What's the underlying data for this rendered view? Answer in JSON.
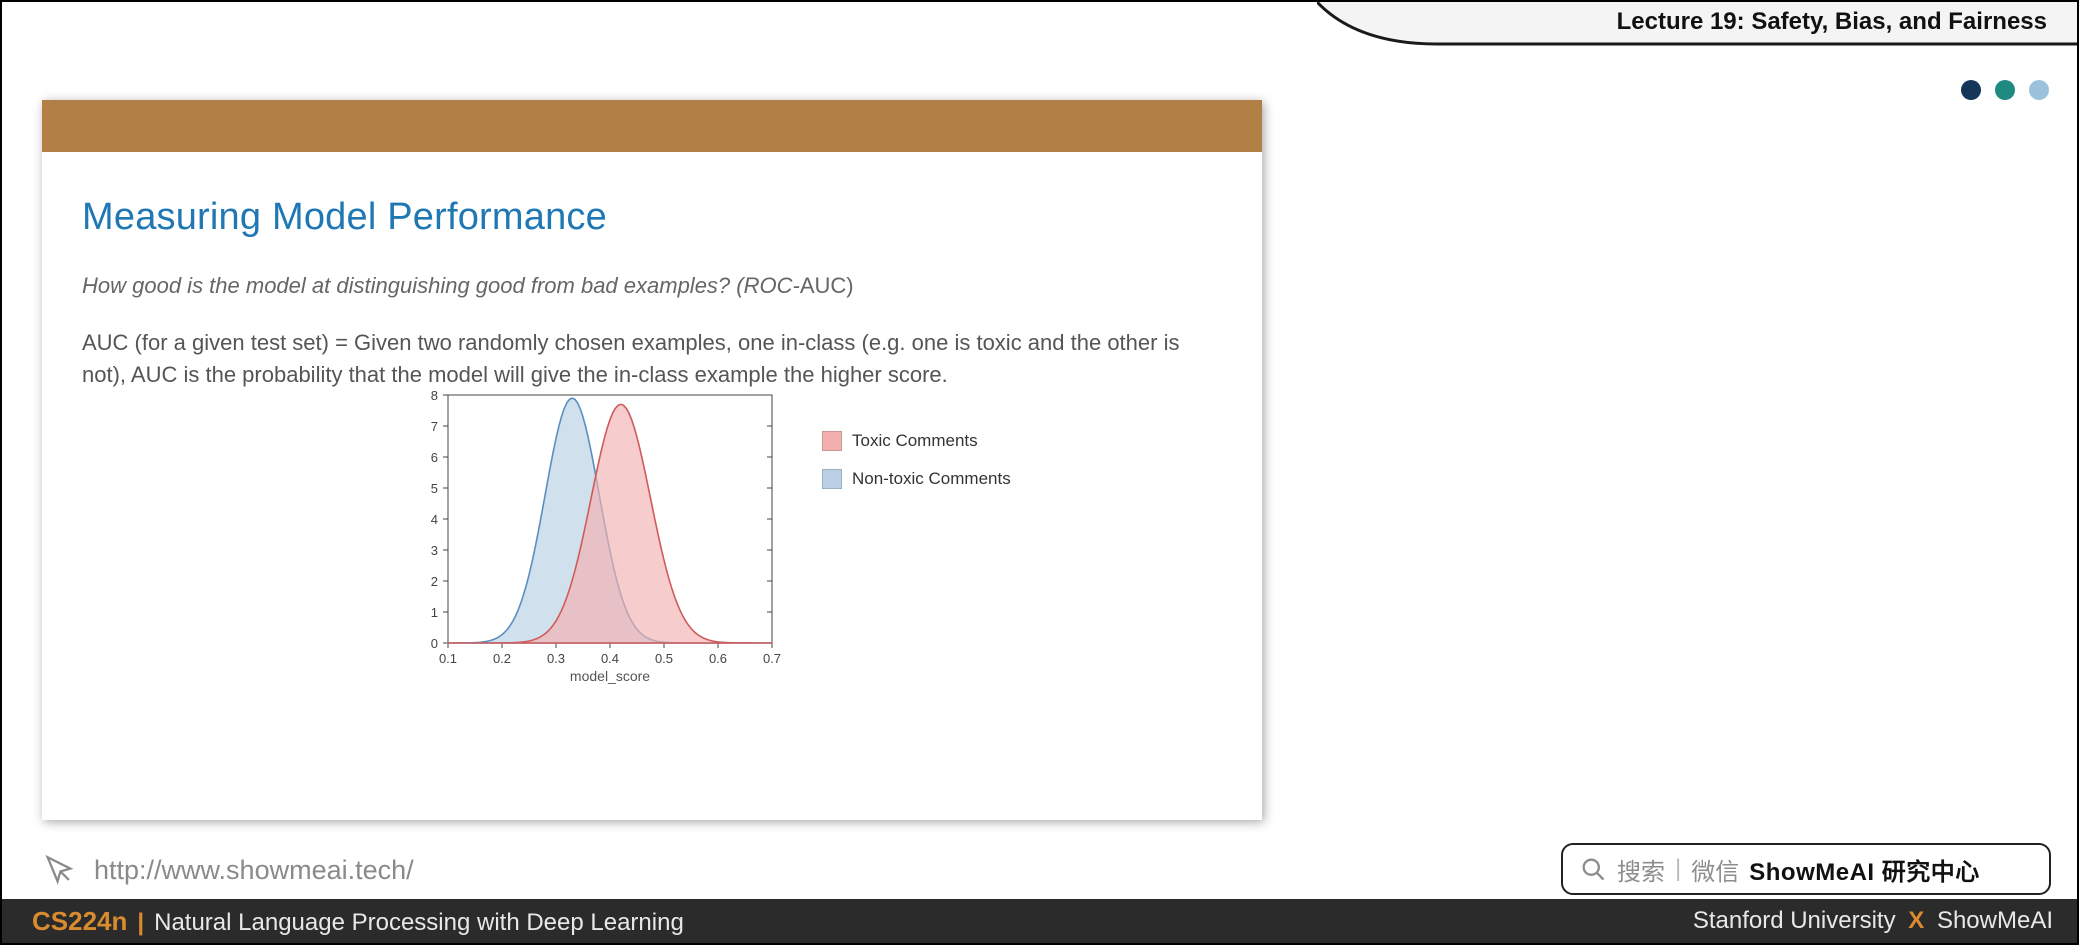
{
  "header": {
    "lecture_title": "Lecture 19: Safety, Bias, and Fairness"
  },
  "dots": {
    "c1": "#14365a",
    "c2": "#1f8a82",
    "c3": "#9cc1db"
  },
  "slide": {
    "title": "Measuring Model Performance",
    "subtitle_italic": "How good is the model at distinguishing good from bad examples? (ROC-",
    "subtitle_plain": "AUC)",
    "desc": "AUC (for a given test set) = Given two randomly chosen examples, one in-class (e.g. one is toxic and the other is not), AUC is the probability that the model will give the in-class example the higher score."
  },
  "legend": {
    "toxic_label": "Toxic Comments",
    "toxic_color": "#f2b0b0",
    "nontoxic_label": "Non-toxic Comments",
    "nontoxic_color": "#b8cfe4"
  },
  "chart_data": {
    "type": "area",
    "xlabel": "model_score",
    "ylabel": "",
    "xlim": [
      0.1,
      0.7
    ],
    "ylim": [
      0,
      8
    ],
    "xticks": [
      0.1,
      0.2,
      0.3,
      0.4,
      0.5,
      0.6,
      0.7
    ],
    "yticks": [
      0,
      1,
      2,
      3,
      4,
      5,
      6,
      7,
      8
    ],
    "series": [
      {
        "name": "Non-toxic Comments",
        "mean": 0.33,
        "sigma": 0.05,
        "peak": 7.9,
        "color_fill": "#b8cfe4",
        "color_line": "#5b8fbf"
      },
      {
        "name": "Toxic Comments",
        "mean": 0.42,
        "sigma": 0.055,
        "peak": 7.7,
        "color_fill": "#f2b0b0",
        "color_line": "#cf5b5b"
      }
    ]
  },
  "url": "http://www.showmeai.tech/",
  "search": {
    "hint1": "搜索",
    "hint2": "微信",
    "strong": "ShowMeAI 研究中心"
  },
  "footer": {
    "code": "CS224n",
    "course": "Natural Language Processing with Deep Learning",
    "org1": "Stanford University",
    "org2": "ShowMeAI"
  }
}
